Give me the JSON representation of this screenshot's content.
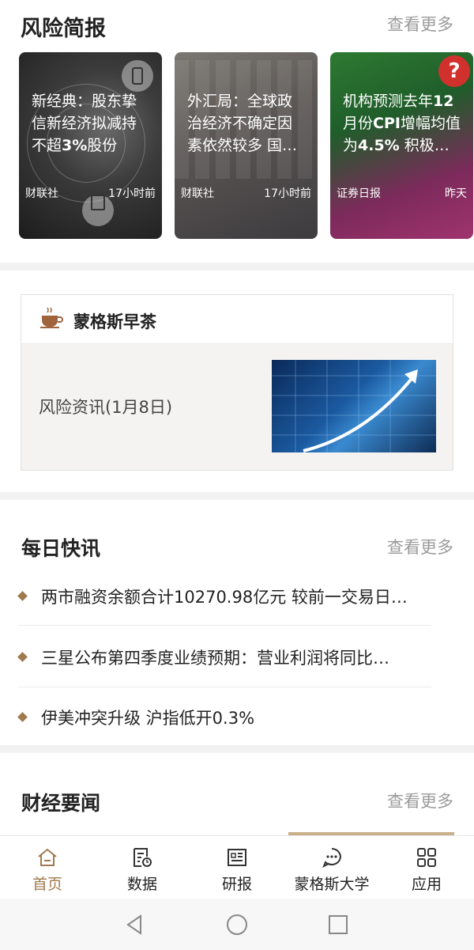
{
  "risk_brief": {
    "title": "风险简报",
    "more": "查看更多",
    "cards": [
      {
        "text_pre": "新经典：股东挚信新经济拟减持不超",
        "text_bold": "3%",
        "text_post": "股份",
        "source": "财联社",
        "time": "17小时前"
      },
      {
        "text_pre": "外汇局：全球政治经济不确定因素依然较多 国…",
        "text_bold": "",
        "text_post": "",
        "source": "财联社",
        "time": "17小时前"
      },
      {
        "text_pre": "机构预测去年",
        "text_bold": "12",
        "text_post": "月份",
        "text_bold2": "CPI",
        "text_post2": "增幅均值为",
        "text_bold3": "4.5%",
        "text_post3": " 积极…",
        "source": "证券日报",
        "time": "昨天"
      }
    ]
  },
  "morning_tea": {
    "title": "蒙格斯早茶",
    "item": "风险资讯(1月8日)"
  },
  "daily_news": {
    "title": "每日快讯",
    "more": "查看更多",
    "items": [
      "两市融资余额合计10270.98亿元 较前一交易日…",
      "三星公布第四季度业绩预期：营业利润将同比…",
      "伊美冲突升级 沪指低开0.3%"
    ]
  },
  "finance_news": {
    "title": "财经要闻",
    "more": "查看更多"
  },
  "tabbar": {
    "items": [
      {
        "label": "首页",
        "icon": "home-icon"
      },
      {
        "label": "数据",
        "icon": "data-icon"
      },
      {
        "label": "研报",
        "icon": "report-icon"
      },
      {
        "label": "蒙格斯大学",
        "icon": "chat-icon"
      },
      {
        "label": "应用",
        "icon": "apps-icon"
      }
    ],
    "active_index": 0
  },
  "colors": {
    "accent": "#a07a4e",
    "muted": "#9b9b9b"
  }
}
